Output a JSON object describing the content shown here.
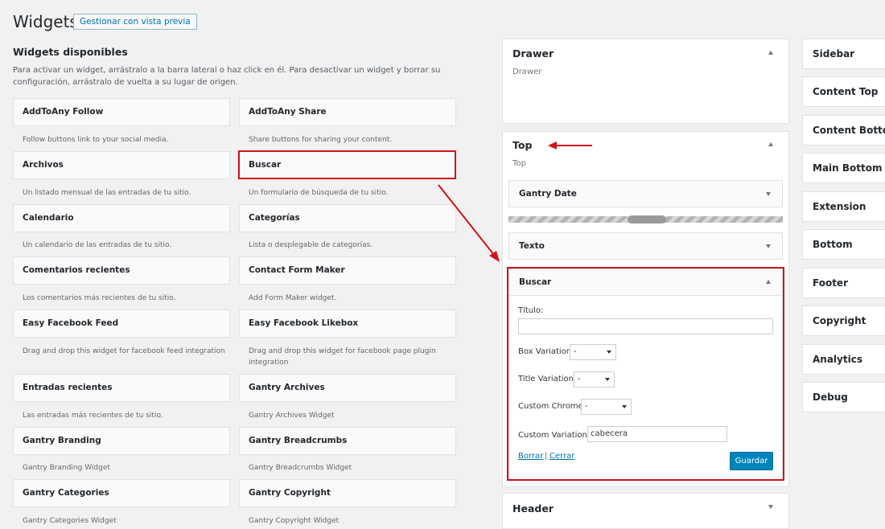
{
  "header": {
    "title": "Widgets",
    "manage_button": "Gestionar con vista previa"
  },
  "available": {
    "title": "Widgets disponibles",
    "description": "Para activar un widget, arrástralo a la barra lateral o haz click en él. Para desactivar un widget y borrar su configuración, arrástralo de vuelta a su lugar de origen."
  },
  "widgets": [
    {
      "name": "AddToAny Follow",
      "desc": "Follow buttons link to your social media."
    },
    {
      "name": "AddToAny Share",
      "desc": "Share buttons for sharing your content."
    },
    {
      "name": "Archivos",
      "desc": "Un listado mensual de las entradas de tu sitio."
    },
    {
      "name": "Buscar",
      "desc": "Un formulario de búsqueda de tu sitio."
    },
    {
      "name": "Calendario",
      "desc": "Un calendario de las entradas de tu sitio."
    },
    {
      "name": "Categorías",
      "desc": "Lista o desplegable de categorías."
    },
    {
      "name": "Comentarios recientes",
      "desc": "Los comentarios más recientes de tu sitio."
    },
    {
      "name": "Contact Form Maker",
      "desc": "Add Form Maker widget."
    },
    {
      "name": "Easy Facebook Feed",
      "desc": "Drag and drop this widget for facebook feed integration"
    },
    {
      "name": "Easy Facebook Likebox",
      "desc": "Drag and drop this widget for facebook page plugin integration"
    },
    {
      "name": "Entradas recientes",
      "desc": "Las entradas más recientes de tu sitio."
    },
    {
      "name": "Gantry Archives",
      "desc": "Gantry Archives Widget"
    },
    {
      "name": "Gantry Branding",
      "desc": "Gantry Branding Widget"
    },
    {
      "name": "Gantry Breadcrumbs",
      "desc": "Gantry Breadcrumbs Widget"
    },
    {
      "name": "Gantry Categories",
      "desc": "Gantry Categories Widget"
    },
    {
      "name": "Gantry Copyright",
      "desc": "Gantry Copyright Widget"
    }
  ],
  "areas": {
    "drawer": {
      "title": "Drawer",
      "subtitle": "Drawer"
    },
    "top": {
      "title": "Top",
      "subtitle": "Top",
      "widgets": [
        "Gantry Date",
        "Texto"
      ],
      "buscar": {
        "title": "Buscar",
        "titulo_label": "Título:",
        "titulo_value": "",
        "box_variation_label": "Box Variation",
        "box_variation_value": "-",
        "title_variation_label": "Title Variation",
        "title_variation_value": "-",
        "custom_chrome_label": "Custom Chrome",
        "custom_chrome_value": "-",
        "custom_variations_label": "Custom Variations",
        "custom_variations_value": "cabecera",
        "delete_link": "Borrar",
        "separator": "|",
        "close_link": "Cerrar",
        "save_button": "Guardar"
      }
    },
    "header": {
      "title": "Header"
    }
  },
  "right_sidebars": [
    "Sidebar",
    "Content Top",
    "Content Bottom",
    "Main Bottom",
    "Extension",
    "Bottom",
    "Footer",
    "Copyright",
    "Analytics",
    "Debug"
  ],
  "colors": {
    "annotation": "#d0121b",
    "primary": "#0085ba",
    "link": "#0073aa"
  }
}
